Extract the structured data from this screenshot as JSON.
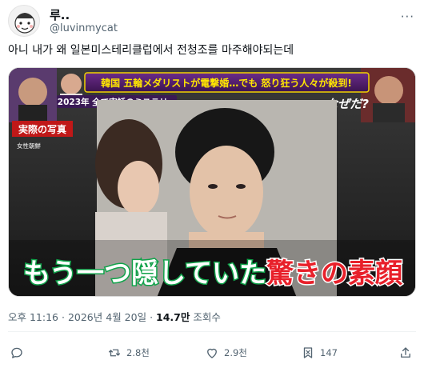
{
  "author": {
    "display_name": "루..",
    "handle": "@luvinmycat"
  },
  "more_label": "···",
  "tweet_text": "아니 내가 왜 일본미스테리클럽에서 전청조를 마주해야되는데",
  "image": {
    "banner_main": "韓国 五輪メダリストが電撃婚…でも 怒り狂う人々が殺到!",
    "banner_sub": "2023年 全て実話のミステリー",
    "why_caption": "なぜだ?",
    "photo_label": "実際の写真",
    "photo_source": "女性朝鮮",
    "caption_white": "もう一つ隠していた",
    "caption_red": "驚きの素顔"
  },
  "meta": {
    "time": "오후 11:16",
    "separator": "·",
    "date": "2026년 4월 20일",
    "views_count": "14.7만",
    "views_label": "조회수"
  },
  "actions": {
    "reply_icon": "reply-icon",
    "retweet_icon": "retweet-icon",
    "retweet_count": "2.8천",
    "like_icon": "heart-icon",
    "like_count": "2.9천",
    "bookmark_icon": "bookmark-icon",
    "bookmark_count": "147",
    "share_icon": "share-icon"
  },
  "colors": {
    "text_primary": "#0f1419",
    "text_secondary": "#536471",
    "caption_red": "#e8202a",
    "caption_outline": "#10a34a",
    "banner_yellow": "#ffe600"
  }
}
